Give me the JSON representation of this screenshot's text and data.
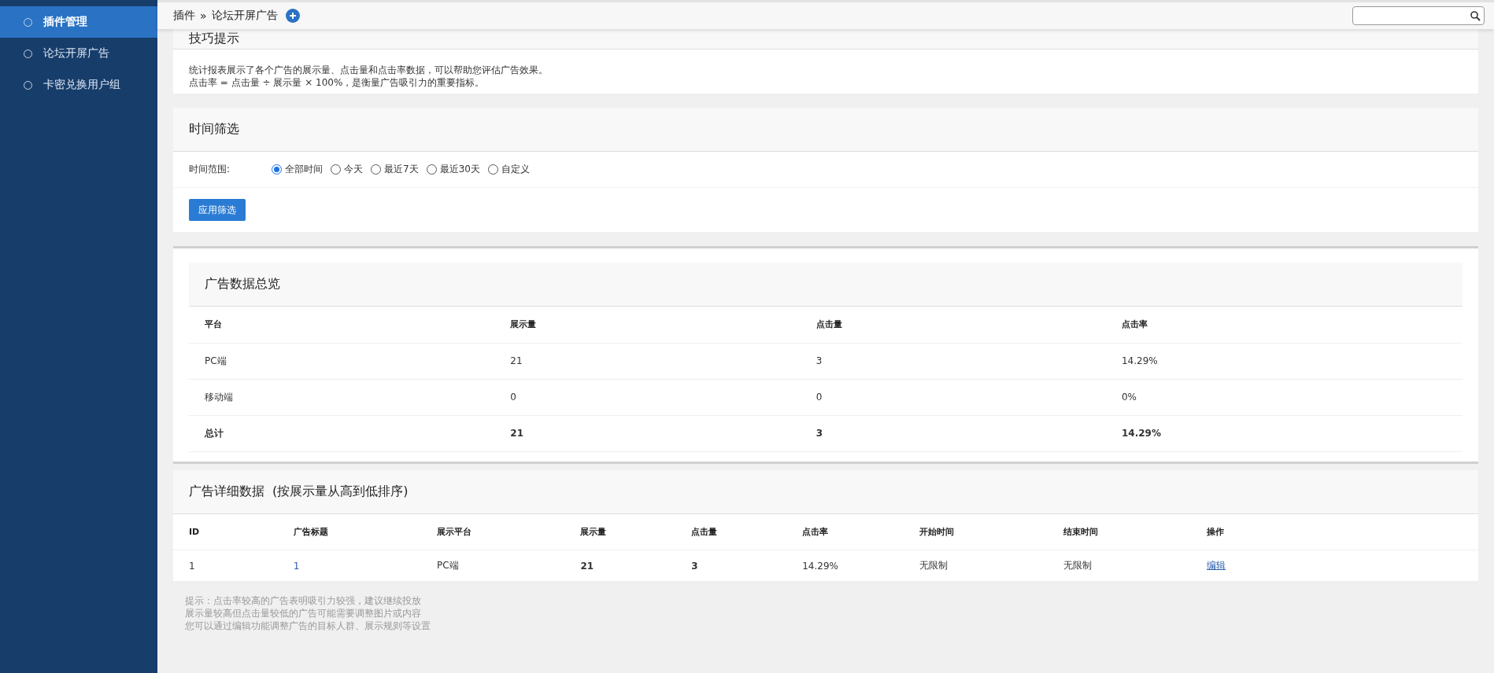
{
  "sidebar": {
    "items": [
      {
        "label": "插件管理",
        "selected": true
      },
      {
        "label": "论坛开屏广告",
        "selected": false
      },
      {
        "label": "卡密兑换用户组",
        "selected": false
      }
    ]
  },
  "header": {
    "breadcrumb": [
      "插件",
      "»",
      "论坛开屏广告"
    ]
  },
  "tips": {
    "title": "技巧提示",
    "lines": [
      "统计报表展示了各个广告的展示量、点击量和点击率数据，可以帮助您评估广告效果。",
      "点击率 = 点击量 ÷ 展示量 × 100%，是衡量广告吸引力的重要指标。"
    ]
  },
  "filter": {
    "title": "时间筛选",
    "label": "时间范围:",
    "options": [
      {
        "label": "全部时间",
        "selected": true
      },
      {
        "label": "今天",
        "selected": false
      },
      {
        "label": "最近7天",
        "selected": false
      },
      {
        "label": "最近30天",
        "selected": false
      },
      {
        "label": "自定义",
        "selected": false
      }
    ],
    "button": "应用筛选"
  },
  "overview": {
    "title": "广告数据总览",
    "columns": [
      "平台",
      "展示量",
      "点击量",
      "点击率"
    ],
    "rows": [
      {
        "cells": [
          "PC端",
          "21",
          "3",
          "14.29%"
        ],
        "bold": false
      },
      {
        "cells": [
          "移动端",
          "0",
          "0",
          "0%"
        ],
        "bold": false
      },
      {
        "cells": [
          "总计",
          "21",
          "3",
          "14.29%"
        ],
        "bold": true
      }
    ]
  },
  "detail": {
    "title": "广告详细数据",
    "subtitle": "(按展示量从高到低排序)",
    "columns": [
      "ID",
      "广告标题",
      "展示平台",
      "展示量",
      "点击量",
      "点击率",
      "开始时间",
      "结束时间",
      "操作"
    ],
    "rows": [
      {
        "id": "1",
        "title": "1",
        "platform": "PC端",
        "views": "21",
        "clicks": "3",
        "rate": "14.29%",
        "start": "无限制",
        "end": "无限制",
        "action": "编辑"
      }
    ]
  },
  "notes": [
    "提示：点击率较高的广告表明吸引力较强，建议继续投放",
    "展示量较高但点击量较低的广告可能需要调整图片或内容",
    "您可以通过编辑功能调整广告的目标人群、展示规则等设置"
  ]
}
